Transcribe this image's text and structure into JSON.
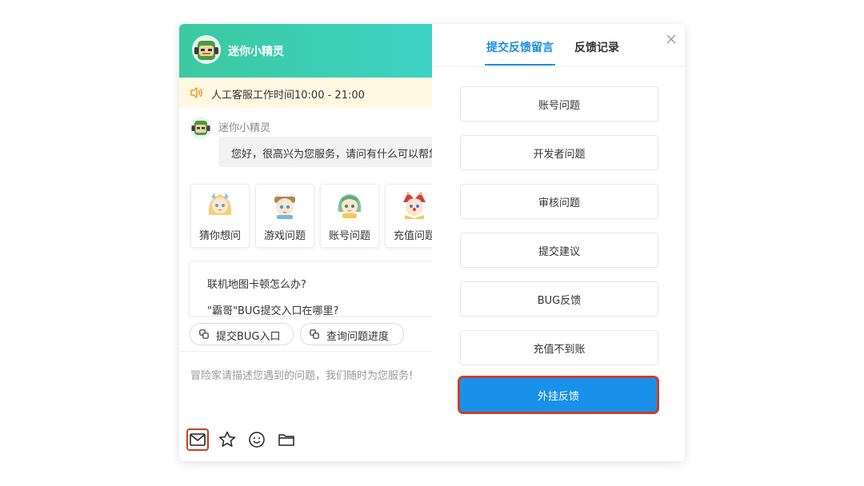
{
  "chat": {
    "title": "迷你小精灵",
    "notice": "人工客服工作时间10:00 - 21:00",
    "bot_name": "迷你小精灵",
    "greeting": "您好，很高兴为您服务，请问有什么可以帮您",
    "cards": [
      "猜你想问",
      "游戏问题",
      "账号问题",
      "充值问题"
    ],
    "faq": [
      "联机地图卡顿怎么办?",
      "\"霸哥\"BUG提交入口在哪里?"
    ],
    "chips": [
      "提交BUG入口",
      "查询问题进度"
    ],
    "input_placeholder": "冒险家请描述您遇到的问题，我们随时为您服务!"
  },
  "feedback": {
    "tabs": [
      "提交反馈留言",
      "反馈记录"
    ],
    "options": [
      "账号问题",
      "开发者问题",
      "审核问题",
      "提交建议",
      "BUG反馈",
      "充值不到账"
    ],
    "primary_option": "外挂反馈"
  },
  "colors": {
    "header_gradient_start": "#3cc9a0",
    "header_gradient_end": "#3dd2c4",
    "accent_blue": "#1a8cde",
    "primary_button": "#1991eb",
    "highlight_red": "#c8402a",
    "notice_bg": "#fff8e3"
  },
  "icons": [
    "speaker-icon",
    "mail-icon",
    "star-icon",
    "emoji-icon",
    "folder-icon",
    "close-icon",
    "link-icon"
  ]
}
